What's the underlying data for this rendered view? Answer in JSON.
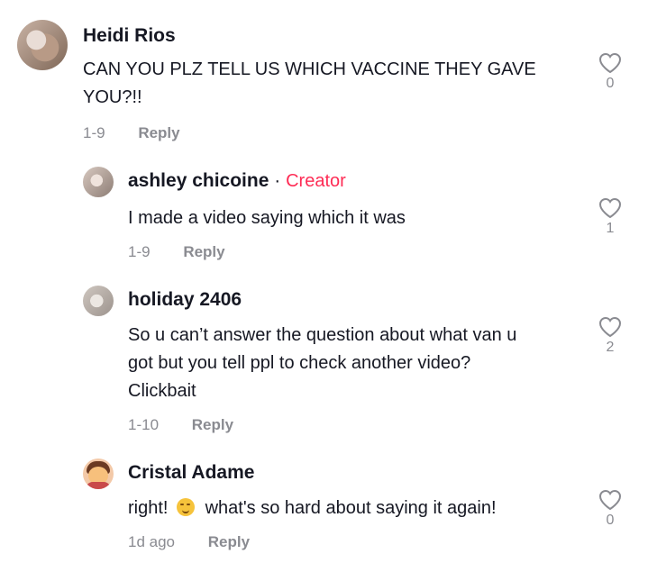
{
  "comments": [
    {
      "author": "Heidi Rios",
      "text_lines": [
        "CAN YOU PLZ TELL US WHICH VACCINE THEY GAVE",
        "YOU?!!"
      ],
      "date": "1-9",
      "reply_label": "Reply",
      "likes": "0"
    },
    {
      "author": "ashley chicoine",
      "separator": "·",
      "badge": "Creator",
      "text": "I made a video saying which it was",
      "date": "1-9",
      "reply_label": "Reply",
      "likes": "1"
    },
    {
      "author": "holiday 2406",
      "text_lines": [
        "So u can’t answer the question about what van u",
        "got but you tell ppl to check another video?",
        "Clickbait"
      ],
      "date": "1-10",
      "reply_label": "Reply",
      "likes": "2"
    },
    {
      "author": "Cristal Adame",
      "text_before": "right!",
      "emoji_icon": "smirk-emoji-icon",
      "text_after": "what's so hard about saying it again!",
      "date": "1d ago",
      "reply_label": "Reply",
      "likes": "0"
    }
  ],
  "icons": {
    "like": "heart-outline-icon"
  },
  "colors": {
    "creator_badge": "#fe2c55",
    "meta_gray": "#8a8b91",
    "text": "#161823"
  }
}
